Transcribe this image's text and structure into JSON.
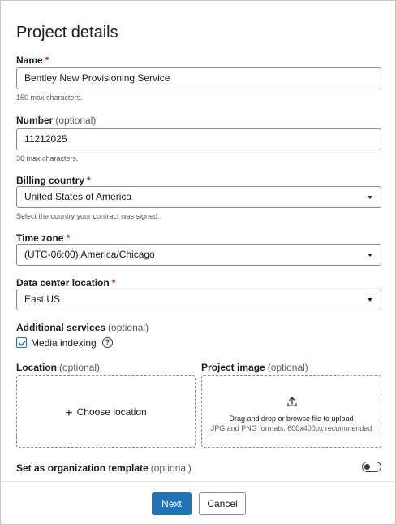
{
  "page": {
    "title": "Project details"
  },
  "name": {
    "label": "Name",
    "required_mark": "*",
    "value": "Bentley New Provisioning Service",
    "hint": "150 max characters."
  },
  "number": {
    "label": "Number",
    "optional": "(optional)",
    "value": "11212025",
    "hint": "36 max characters."
  },
  "billing_country": {
    "label": "Billing country",
    "required_mark": "*",
    "value": "United States of America",
    "hint": "Select the country your contract was signed."
  },
  "time_zone": {
    "label": "Time zone",
    "required_mark": "*",
    "value": "(UTC-06:00) America/Chicago"
  },
  "data_center": {
    "label": "Data center location",
    "required_mark": "*",
    "value": "East US"
  },
  "additional_services": {
    "label": "Additional services",
    "optional": "(optional)",
    "media_indexing_label": "Media indexing",
    "media_indexing_checked": true,
    "help_glyph": "?"
  },
  "location": {
    "label": "Location",
    "optional": "(optional)",
    "choose_plus": "+",
    "choose_label": "Choose location"
  },
  "project_image": {
    "label": "Project image",
    "optional": "(optional)",
    "drop_text": "Drag and drop or browse file to upload",
    "formats_text": "JPG and PNG formats. 600x400px recommended",
    "icon": "upload-icon"
  },
  "org_template": {
    "label": "Set as organization template",
    "optional": "(optional)",
    "enabled": false
  },
  "footer": {
    "next_label": "Next",
    "cancel_label": "Cancel"
  },
  "colors": {
    "accent": "#1f73b7",
    "required": "#c0262d",
    "border": "#8a8a8a"
  }
}
